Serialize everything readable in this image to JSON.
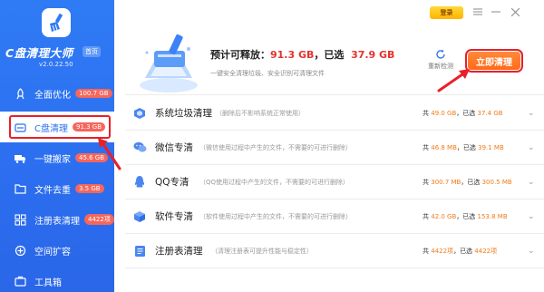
{
  "app": {
    "title": "C盘清理大师",
    "home_badge": "首页",
    "version": "v2.0.22.50"
  },
  "window": {
    "login_label": "登录",
    "menu_icon": "menu-icon",
    "minimize_icon": "minimize-icon",
    "close_icon": "close-icon"
  },
  "sidebar": {
    "items": [
      {
        "label": "全面优化",
        "badge": "100.7 GB",
        "icon": "rocket-icon"
      },
      {
        "label": "C盘清理",
        "badge": "91.3 GB",
        "icon": "broom-icon",
        "active": true
      },
      {
        "label": "一键搬家",
        "badge": "45.6 GB",
        "icon": "truck-icon"
      },
      {
        "label": "文件去重",
        "badge": "3.5 GB",
        "icon": "folder-icon"
      },
      {
        "label": "注册表清理",
        "badge": "4422项",
        "icon": "grid-icon"
      },
      {
        "label": "空间扩容",
        "badge": "",
        "icon": "expand-icon"
      },
      {
        "label": "工具箱",
        "badge": "",
        "icon": "toolbox-icon"
      }
    ]
  },
  "header": {
    "summary_prefix": "预计可释放：",
    "total": "91.3 GB",
    "summary_mid": "，已选",
    "selected": "37.9 GB",
    "subline": "一键安全清理垃圾、安全识别可清理文件",
    "rescan_label": "重新检测",
    "clean_label": "立即清理"
  },
  "rows": [
    {
      "title": "系统垃圾清理",
      "desc": "（删除后不影响系统正常使用）",
      "total_prefix": "共",
      "total": "49.0 GB",
      "sel_prefix": "，已选",
      "selected": "37.4 GB",
      "icon": "system-icon"
    },
    {
      "title": "微信专清",
      "desc": "（微信使用过程中产生的文件，不需要的可进行删除）",
      "total_prefix": "共",
      "total": "46.8 MB",
      "sel_prefix": "，已选",
      "selected": "39.1 MB",
      "icon": "wechat-icon"
    },
    {
      "title": "QQ专清",
      "desc": "（QQ使用过程中产生的文件，不需要的可进行删除）",
      "total_prefix": "共",
      "total": "300.7 MB",
      "sel_prefix": "，已选",
      "selected": "300.5 MB",
      "icon": "qq-icon"
    },
    {
      "title": "软件专清",
      "desc": "（软件使用过程中产生的文件，不需要的可进行删除）",
      "total_prefix": "共",
      "total": "42.0 GB",
      "sel_prefix": "，已选",
      "selected": "153.8 MB",
      "icon": "software-icon"
    },
    {
      "title": "注册表清理",
      "desc": "（清理注册表可提升性能与稳定性）",
      "total_prefix": "共",
      "total": "4422项",
      "sel_prefix": "，已选",
      "selected": "4422项",
      "icon": "registry-icon"
    }
  ],
  "colors": {
    "accent": "#2b6ff0",
    "badge": "#f5665c",
    "highlight": "#e8202a",
    "orange": "#f07a1a",
    "clean_button": "#ff6a1a"
  }
}
